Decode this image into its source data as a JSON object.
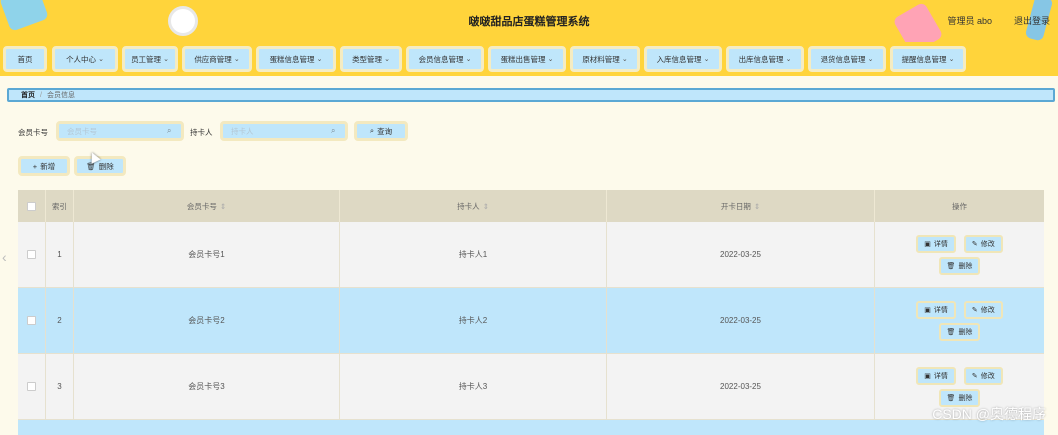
{
  "header": {
    "title": "啵啵甜品店蛋糕管理系统",
    "admin": "管理员 abo",
    "logout": "退出登录"
  },
  "nav": [
    {
      "label": "首页",
      "dropdown": false
    },
    {
      "label": "个人中心",
      "dropdown": true
    },
    {
      "label": "员工管理",
      "dropdown": true
    },
    {
      "label": "供应商管理",
      "dropdown": true
    },
    {
      "label": "蛋糕信息管理",
      "dropdown": true
    },
    {
      "label": "类型管理",
      "dropdown": true
    },
    {
      "label": "会员信息管理",
      "dropdown": true
    },
    {
      "label": "蛋糕出售管理",
      "dropdown": true
    },
    {
      "label": "原材料管理",
      "dropdown": true
    },
    {
      "label": "入库信息管理",
      "dropdown": true
    },
    {
      "label": "出库信息管理",
      "dropdown": true
    },
    {
      "label": "退货信息管理",
      "dropdown": true
    },
    {
      "label": "提醒信息管理",
      "dropdown": true
    }
  ],
  "breadcrumb": {
    "home": "首页",
    "current": "会员信息"
  },
  "search": {
    "card_label": "会员卡号",
    "card_placeholder": "会员卡号",
    "holder_label": "持卡人",
    "holder_placeholder": "持卡人",
    "query_button": "查询"
  },
  "actions": {
    "add": "新增",
    "delete": "删除"
  },
  "table": {
    "headers": [
      "索引",
      "会员卡号",
      "持卡人",
      "开卡日期",
      "操作"
    ],
    "rows": [
      {
        "index": "1",
        "card": "会员卡号1",
        "holder": "持卡人1",
        "date": "2022-03-25"
      },
      {
        "index": "2",
        "card": "会员卡号2",
        "holder": "持卡人2",
        "date": "2022-03-25"
      },
      {
        "index": "3",
        "card": "会员卡号3",
        "holder": "持卡人3",
        "date": "2022-03-25"
      }
    ],
    "op_detail": "详情",
    "op_edit": "修改",
    "op_delete": "删除"
  },
  "watermark": "CSDN @奥德程序"
}
